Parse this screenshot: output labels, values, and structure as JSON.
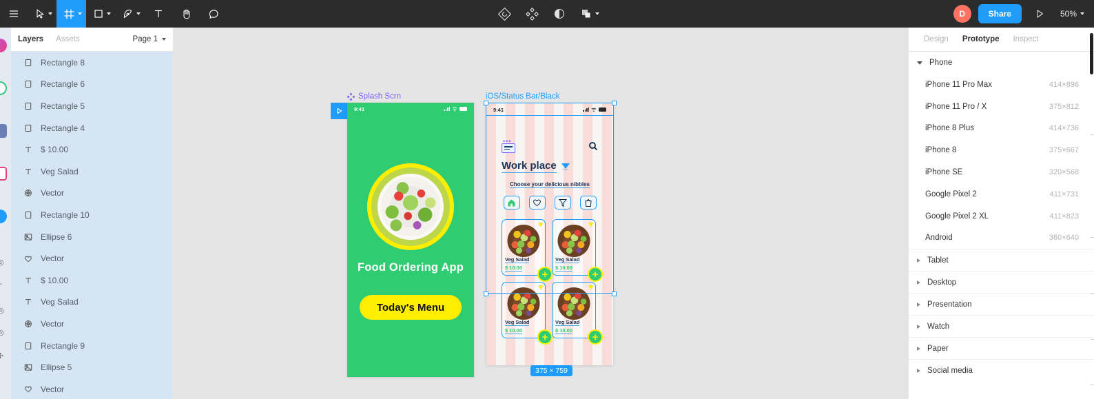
{
  "toolbar": {
    "menu_icon": "hamburger-menu-icon",
    "tools": [
      {
        "name": "move-tool",
        "icon": "cursor-arrow-icon",
        "has_caret": true,
        "active": false
      },
      {
        "name": "frame-tool",
        "icon": "frame-icon",
        "has_caret": true,
        "active": true
      },
      {
        "name": "shape-tool",
        "icon": "square-icon",
        "has_caret": true,
        "active": false
      },
      {
        "name": "pen-tool",
        "icon": "pen-icon",
        "has_caret": true,
        "active": false
      },
      {
        "name": "text-tool",
        "icon": "text-T-icon",
        "has_caret": false,
        "active": false
      },
      {
        "name": "hand-tool",
        "icon": "hand-icon",
        "has_caret": false,
        "active": false
      },
      {
        "name": "comment-tool",
        "icon": "comment-bubble-icon",
        "has_caret": false,
        "active": false
      }
    ],
    "center_tools": [
      {
        "name": "component-icon",
        "icon": "component-diamond-outline-icon"
      },
      {
        "name": "create-component-icon",
        "icon": "four-diamond-icon"
      },
      {
        "name": "mask-icon",
        "icon": "half-circle-mask-icon"
      },
      {
        "name": "boolean-icon",
        "icon": "union-shapes-icon",
        "has_caret": true
      }
    ],
    "avatar_initial": "D",
    "avatar_color": "#ff7262",
    "share_label": "Share",
    "present_icon": "play-triangle-icon",
    "zoom_level": "50%",
    "accent_color": "#1f9cfb"
  },
  "left_panel": {
    "tabs": [
      {
        "label": "Layers",
        "active": true
      },
      {
        "label": "Assets",
        "active": false
      }
    ],
    "page_selector": "Page 1",
    "layers": [
      {
        "icon": "rectangle-icon",
        "name": "Rectangle 8"
      },
      {
        "icon": "rectangle-icon",
        "name": "Rectangle 6"
      },
      {
        "icon": "rectangle-icon",
        "name": "Rectangle 5"
      },
      {
        "icon": "rectangle-icon",
        "name": "Rectangle 4"
      },
      {
        "icon": "text-icon",
        "name": "$ 10.00"
      },
      {
        "icon": "text-icon",
        "name": "Veg Salad"
      },
      {
        "icon": "vector-icon",
        "name": "Vector"
      },
      {
        "icon": "rectangle-icon",
        "name": "Rectangle 10"
      },
      {
        "icon": "image-icon",
        "name": "Ellipse 6"
      },
      {
        "icon": "heart-icon",
        "name": "Vector"
      },
      {
        "icon": "text-icon",
        "name": "$ 10.00"
      },
      {
        "icon": "text-icon",
        "name": "Veg Salad"
      },
      {
        "icon": "vector-icon",
        "name": "Vector"
      },
      {
        "icon": "rectangle-icon",
        "name": "Rectangle 9"
      },
      {
        "icon": "image-icon",
        "name": "Ellipse 5"
      },
      {
        "icon": "heart-icon",
        "name": "Vector"
      }
    ]
  },
  "canvas": {
    "splash_frame": {
      "label": "Splash Scrn",
      "label_icon": "component-diamond-icon",
      "play_badge_icon": "play-triangle-icon",
      "status_time": "9:41",
      "title": "Food Ordering App",
      "cta_label": "Today's Menu",
      "bg_color": "#2fcc71",
      "accent_color": "#ffee00"
    },
    "menu_frame": {
      "label": "iOS/Status Bar/Black",
      "status_time": "9:41",
      "menu_icon": "hamburger-icon",
      "search_icon": "magnifier-icon",
      "location_title": "Work place",
      "location_caret_icon": "triangle-down-icon",
      "subtitle": "Choose your delicious nibbles",
      "nav_items": [
        {
          "name": "home-icon",
          "glyph": "home"
        },
        {
          "name": "heart-icon",
          "glyph": "heart"
        },
        {
          "name": "filter-icon",
          "glyph": "funnel"
        },
        {
          "name": "cart-icon",
          "glyph": "bag"
        }
      ],
      "cards": [
        {
          "name": "Veg Salad",
          "price": "$ 10.00",
          "favorite_icon": "heart-icon",
          "add_label": "+"
        },
        {
          "name": "Veg Salad",
          "price": "$ 10.00",
          "favorite_icon": "heart-icon",
          "add_label": "+"
        },
        {
          "name": "Veg Salad",
          "price": "$ 10.00",
          "favorite_icon": "heart-icon",
          "add_label": "+"
        },
        {
          "name": "Veg Salad",
          "price": "$ 10.00",
          "favorite_icon": "heart-icon",
          "add_label": "+"
        }
      ],
      "selection_size_badge": "375 × 759"
    }
  },
  "right_panel": {
    "tabs": [
      {
        "label": "Design",
        "active": false
      },
      {
        "label": "Prototype",
        "active": true
      },
      {
        "label": "Inspect",
        "active": false
      }
    ],
    "groups": [
      {
        "title": "Phone",
        "expanded": true,
        "items": [
          {
            "name": "iPhone 11 Pro Max",
            "size": "414×896"
          },
          {
            "name": "iPhone 11 Pro / X",
            "size": "375×812"
          },
          {
            "name": "iPhone 8 Plus",
            "size": "414×736"
          },
          {
            "name": "iPhone 8",
            "size": "375×667"
          },
          {
            "name": "iPhone SE",
            "size": "320×568"
          },
          {
            "name": "Google Pixel 2",
            "size": "411×731"
          },
          {
            "name": "Google Pixel 2 XL",
            "size": "411×823"
          },
          {
            "name": "Android",
            "size": "360×640"
          }
        ]
      },
      {
        "title": "Tablet",
        "expanded": false,
        "items": []
      },
      {
        "title": "Desktop",
        "expanded": false,
        "items": []
      },
      {
        "title": "Presentation",
        "expanded": false,
        "items": []
      },
      {
        "title": "Watch",
        "expanded": false,
        "items": []
      },
      {
        "title": "Paper",
        "expanded": false,
        "items": []
      },
      {
        "title": "Social media",
        "expanded": false,
        "items": []
      }
    ]
  }
}
